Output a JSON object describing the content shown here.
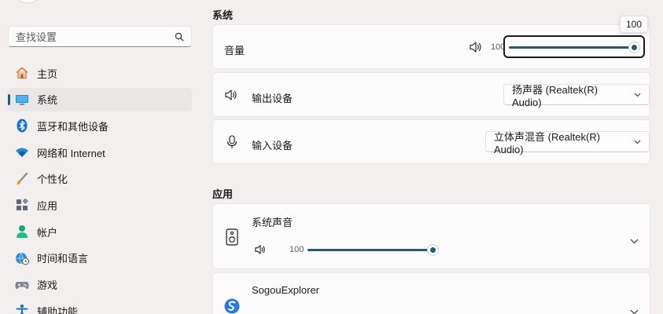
{
  "search": {
    "placeholder": "查找设置"
  },
  "sidebar": {
    "items": [
      {
        "label": "主页",
        "icon": "home-icon"
      },
      {
        "label": "系统",
        "icon": "system-icon",
        "active": true
      },
      {
        "label": "蓝牙和其他设备",
        "icon": "bluetooth-icon"
      },
      {
        "label": "网络和 Internet",
        "icon": "wifi-icon"
      },
      {
        "label": "个性化",
        "icon": "brush-icon"
      },
      {
        "label": "应用",
        "icon": "apps-icon"
      },
      {
        "label": "帐户",
        "icon": "account-icon"
      },
      {
        "label": "时间和语言",
        "icon": "globe-clock-icon"
      },
      {
        "label": "游戏",
        "icon": "gamepad-icon"
      },
      {
        "label": "辅助功能",
        "icon": "accessibility-icon"
      }
    ]
  },
  "system_section": {
    "title": "系统",
    "volume": {
      "label": "音量",
      "value": "100",
      "tooltip": "100",
      "level": 1.0
    },
    "output": {
      "label": "输出设备",
      "device": "扬声器 (Realtek(R) Audio)"
    },
    "input": {
      "label": "输入设备",
      "device": "立体声混音 (Realtek(R) Audio)"
    }
  },
  "apps_section": {
    "title": "应用",
    "apps": [
      {
        "name": "系统声音",
        "volume": "100",
        "level": 1.0
      },
      {
        "name": "SogouExplorer"
      }
    ]
  },
  "colors": {
    "accent": "#1a5f73",
    "background": "#f3efef",
    "card": "#fbfbfb"
  }
}
